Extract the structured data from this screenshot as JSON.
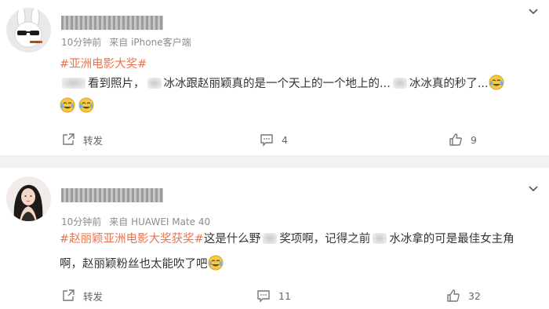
{
  "posts": [
    {
      "meta_time": "10分钟前",
      "meta_source": "来自 iPhone客户端",
      "hashtag": "#亚洲电影大奖#",
      "line1": {
        "a": "看到照片，",
        "b": "冰冰跟赵丽颖真的是一个天上的一个地上的...",
        "c": "冰冰真的秒了..."
      },
      "actions": {
        "repost": "转发",
        "comments": "4",
        "likes": "9"
      }
    },
    {
      "meta_time": "10分钟前",
      "meta_source": "来自 HUAWEI Mate 40",
      "line1": {
        "tag": "#赵丽颖亚洲电影大奖获奖#",
        "a": "这是什么野",
        "b": "奖项啊，记得之前",
        "c": "水冰拿的可是最佳女主角"
      },
      "line2": "啊，赵丽颖粉丝也太能吹了吧",
      "actions": {
        "repost": "转发",
        "comments": "11",
        "likes": "32"
      }
    }
  ],
  "icons": {
    "repost": "share-out-icon",
    "comment": "comment-icon",
    "like": "thumb-up-icon",
    "more": "chevron-down-icon",
    "emoji": "laugh-cry-emoji-icon"
  },
  "colors": {
    "accent": "#eb7350",
    "separator": "#f2f2f2",
    "meta": "#8c8c8c"
  }
}
